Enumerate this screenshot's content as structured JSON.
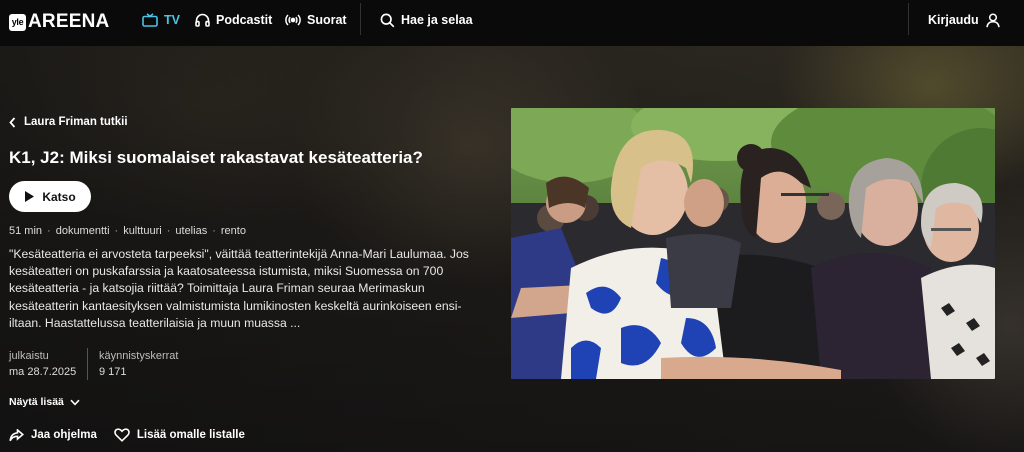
{
  "nav": {
    "logo_badge": "yle",
    "logo_text": "AREENA",
    "tv": "TV",
    "podcasts": "Podcastit",
    "live": "Suorat",
    "search": "Hae ja selaa",
    "login": "Kirjaudu",
    "accent_color": "#4bc4e6"
  },
  "program": {
    "series": "Laura Friman tutkii",
    "title": "K1, J2: Miksi suomalaiset rakastavat kesäteatteria?",
    "play_label": "Katso",
    "tags": [
      "51 min",
      "dokumentti",
      "kulttuuri",
      "utelias",
      "rento"
    ],
    "description": "\"Kesäteatteria ei arvosteta tarpeeksi\", väittää teatterintekijä Anna-Mari Laulumaa. Jos kesäteatteri on puskafarssia ja kaatosateessa istumista, miksi Suomessa on 700 kesäteatteria - ja katsojia riittää? Toimittaja Laura Friman seuraa Merimaskun kesäteatterin kantaesityksen valmistumista lumikinosten keskeltä aurinkoiseen ensi-iltaan. Haastattelussa teatterilaisia ja muun muassa ...",
    "published_label": "julkaistu",
    "published_value": "ma 28.7.2025",
    "plays_label": "käynnistyskerrat",
    "plays_value": "9 171",
    "show_more": "Näytä lisää",
    "share": "Jaa ohjelma",
    "add_to_list": "Lisää omalle listalle"
  },
  "icons": [
    "tv-icon",
    "headphones-icon",
    "broadcast-icon",
    "search-icon",
    "user-icon",
    "chevron-left-icon",
    "play-icon",
    "chevron-down-icon",
    "share-icon",
    "heart-icon"
  ]
}
